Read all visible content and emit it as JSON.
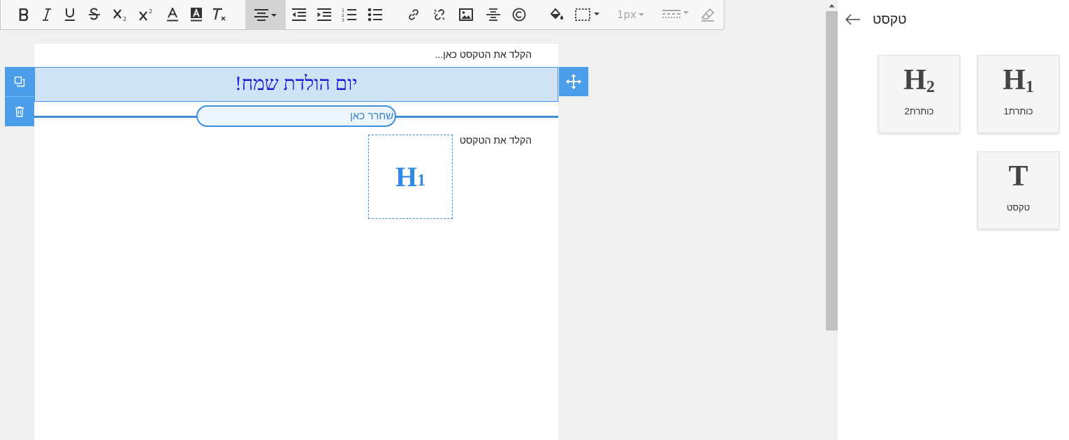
{
  "toolbar": {
    "icons": [
      "bold-icon",
      "italic-icon",
      "underline-icon",
      "strikethrough-icon",
      "subscript-icon",
      "superscript-icon",
      "font-color-icon",
      "highlight-icon",
      "clear-format-icon",
      "align-center-icon",
      "outdent-icon",
      "indent-icon",
      "ordered-list-icon",
      "bullet-list-icon",
      "link-icon",
      "unlink-icon",
      "image-icon",
      "horizontal-line-icon",
      "copyright-icon",
      "fill-color-icon",
      "border-style-icon",
      "line-style-icon",
      "eraser-icon"
    ],
    "border_width": "1px"
  },
  "canvas": {
    "top_placeholder": "הקלד את הטקסט כאן...",
    "heading_text": "יום הולדת שמח!",
    "drop_hint": "שחרר כאן",
    "text_placeholder": "הקלד את הטקסט",
    "drag_ghost": {
      "glyph": "H",
      "sub": "1"
    }
  },
  "panel": {
    "title": "טקסט",
    "tiles": [
      {
        "glyph": "H",
        "sub": "1",
        "label": "כותרת1"
      },
      {
        "glyph": "H",
        "sub": "2",
        "label": "כותרת2"
      },
      {
        "glyph": "T",
        "sub": "",
        "label": "טקסט"
      }
    ]
  },
  "colors": {
    "accent": "#4a9de8",
    "heading_fill": "#cfe2f6",
    "heading_text": "#1a1ad4"
  }
}
